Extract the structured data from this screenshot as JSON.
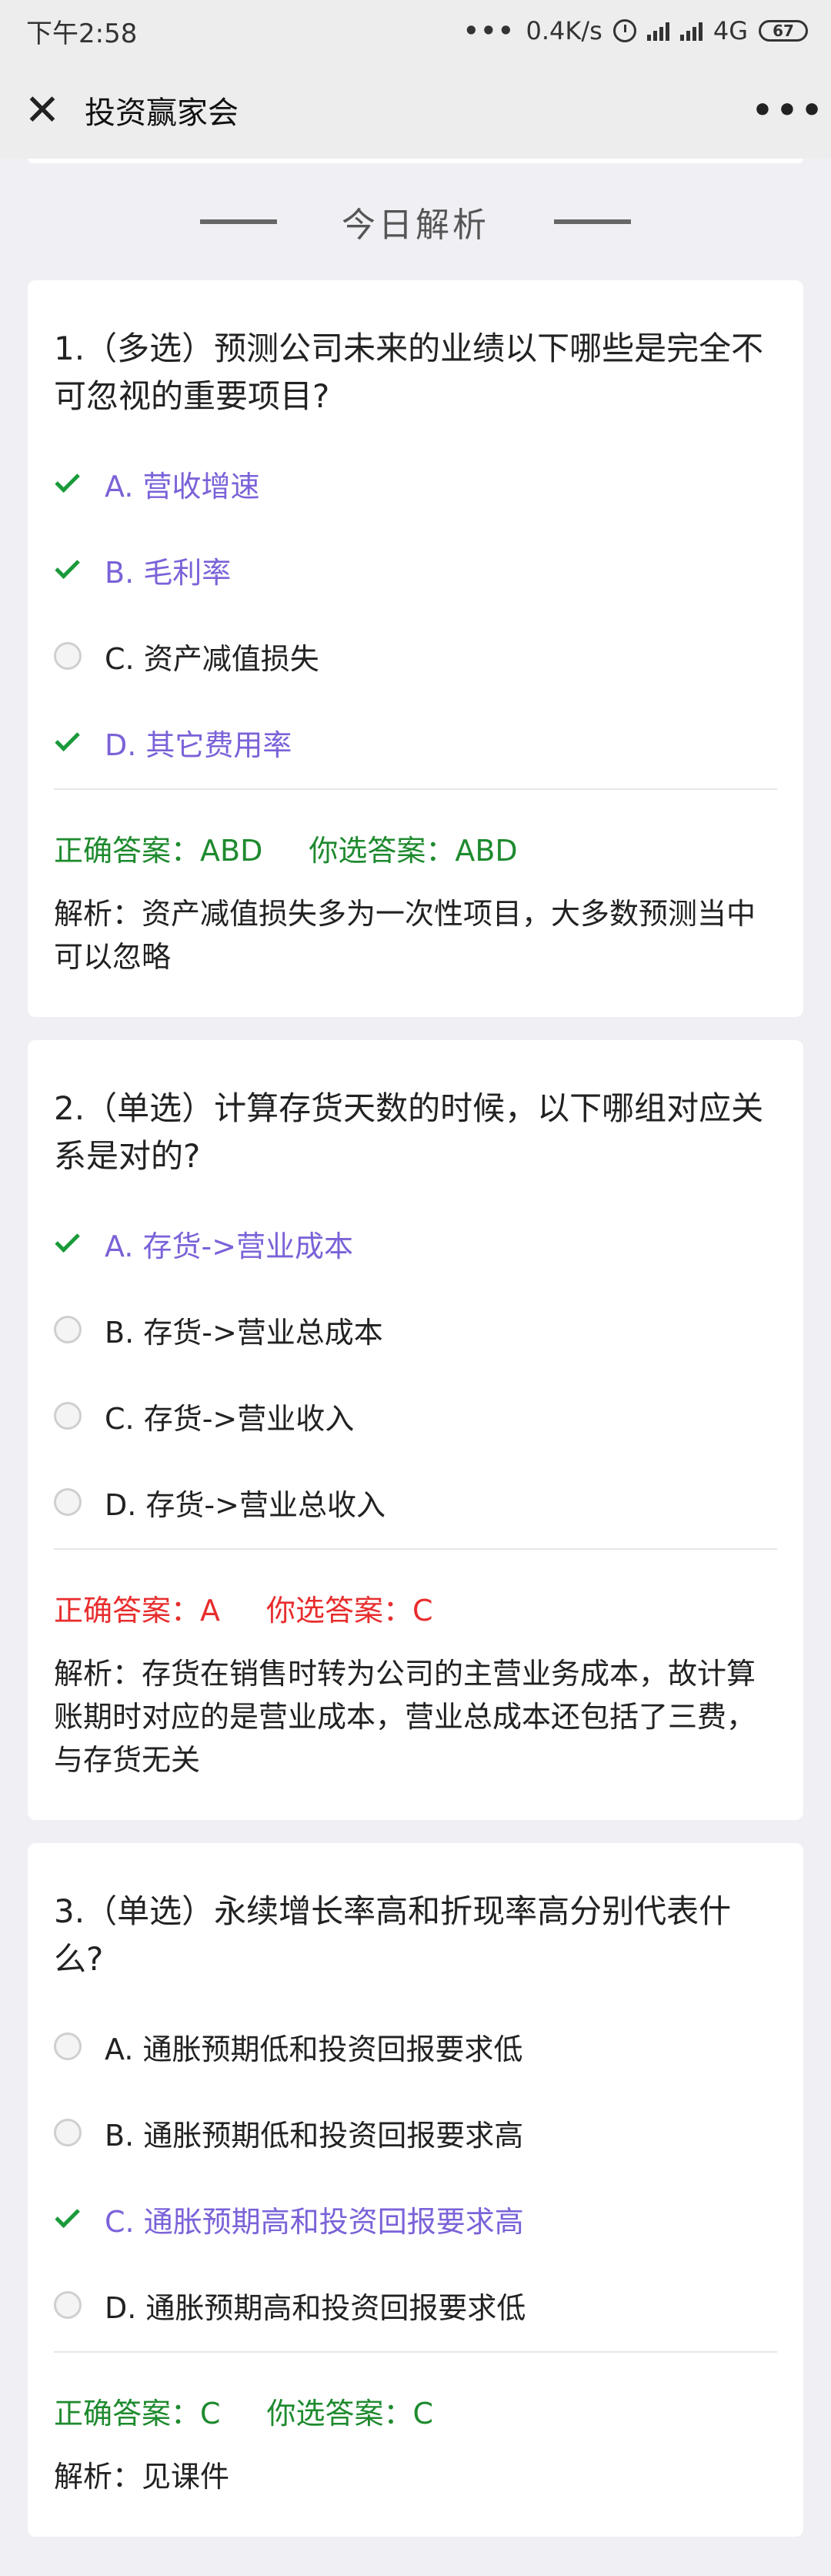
{
  "status_bar": {
    "time": "下午2:58",
    "more": "•••",
    "speed": "0.4K/s",
    "network": "4G",
    "battery": "67"
  },
  "nav": {
    "close": "✕",
    "title": "投资赢家会",
    "more": "•••"
  },
  "section": {
    "title": "今日解析"
  },
  "questions": [
    {
      "question": "1.（多选）预测公司未来的业绩以下哪些是完全不可忽视的重要项目?",
      "options": [
        {
          "label": "A. 营收增速",
          "checked": true
        },
        {
          "label": "B. 毛利率",
          "checked": true
        },
        {
          "label": "C. 资产减值损失",
          "checked": false
        },
        {
          "label": "D. 其它费用率",
          "checked": true
        }
      ],
      "correct_answer": "正确答案：ABD",
      "your_answer": "你选答案：ABD",
      "analysis": "解析：资产减值损失多为一次性项目，大多数预测当中可以忽略"
    },
    {
      "question": "2.（单选）计算存货天数的时候，以下哪组对应关系是对的?",
      "options": [
        {
          "label": "A. 存货->营业成本",
          "checked": true
        },
        {
          "label": "B. 存货->营业总成本",
          "checked": false
        },
        {
          "label": "C. 存货->营业收入",
          "checked": false
        },
        {
          "label": "D. 存货->营业总收入",
          "checked": false
        }
      ],
      "correct_answer": "正确答案：A",
      "your_answer": "你选答案：C",
      "analysis": "解析：存货在销售时转为公司的主营业务成本，故计算账期时对应的是营业成本，营业总成本还包括了三费，与存货无关"
    },
    {
      "question": "3.（单选）永续增长率高和折现率高分别代表什么?",
      "options": [
        {
          "label": "A. 通胀预期低和投资回报要求低",
          "checked": false
        },
        {
          "label": "B. 通胀预期低和投资回报要求高",
          "checked": false
        },
        {
          "label": "C. 通胀预期高和投资回报要求高",
          "checked": true
        },
        {
          "label": "D. 通胀预期高和投资回报要求低",
          "checked": false
        }
      ],
      "correct_answer": "正确答案：C",
      "your_answer": "你选答案：C",
      "analysis": "解析：见课件"
    }
  ],
  "colors": {
    "check": "#1a9a3a",
    "selected_option": "#7b62d8",
    "answer_correct": "#1e8a2e",
    "answer_wrong": "#e82d2d"
  }
}
